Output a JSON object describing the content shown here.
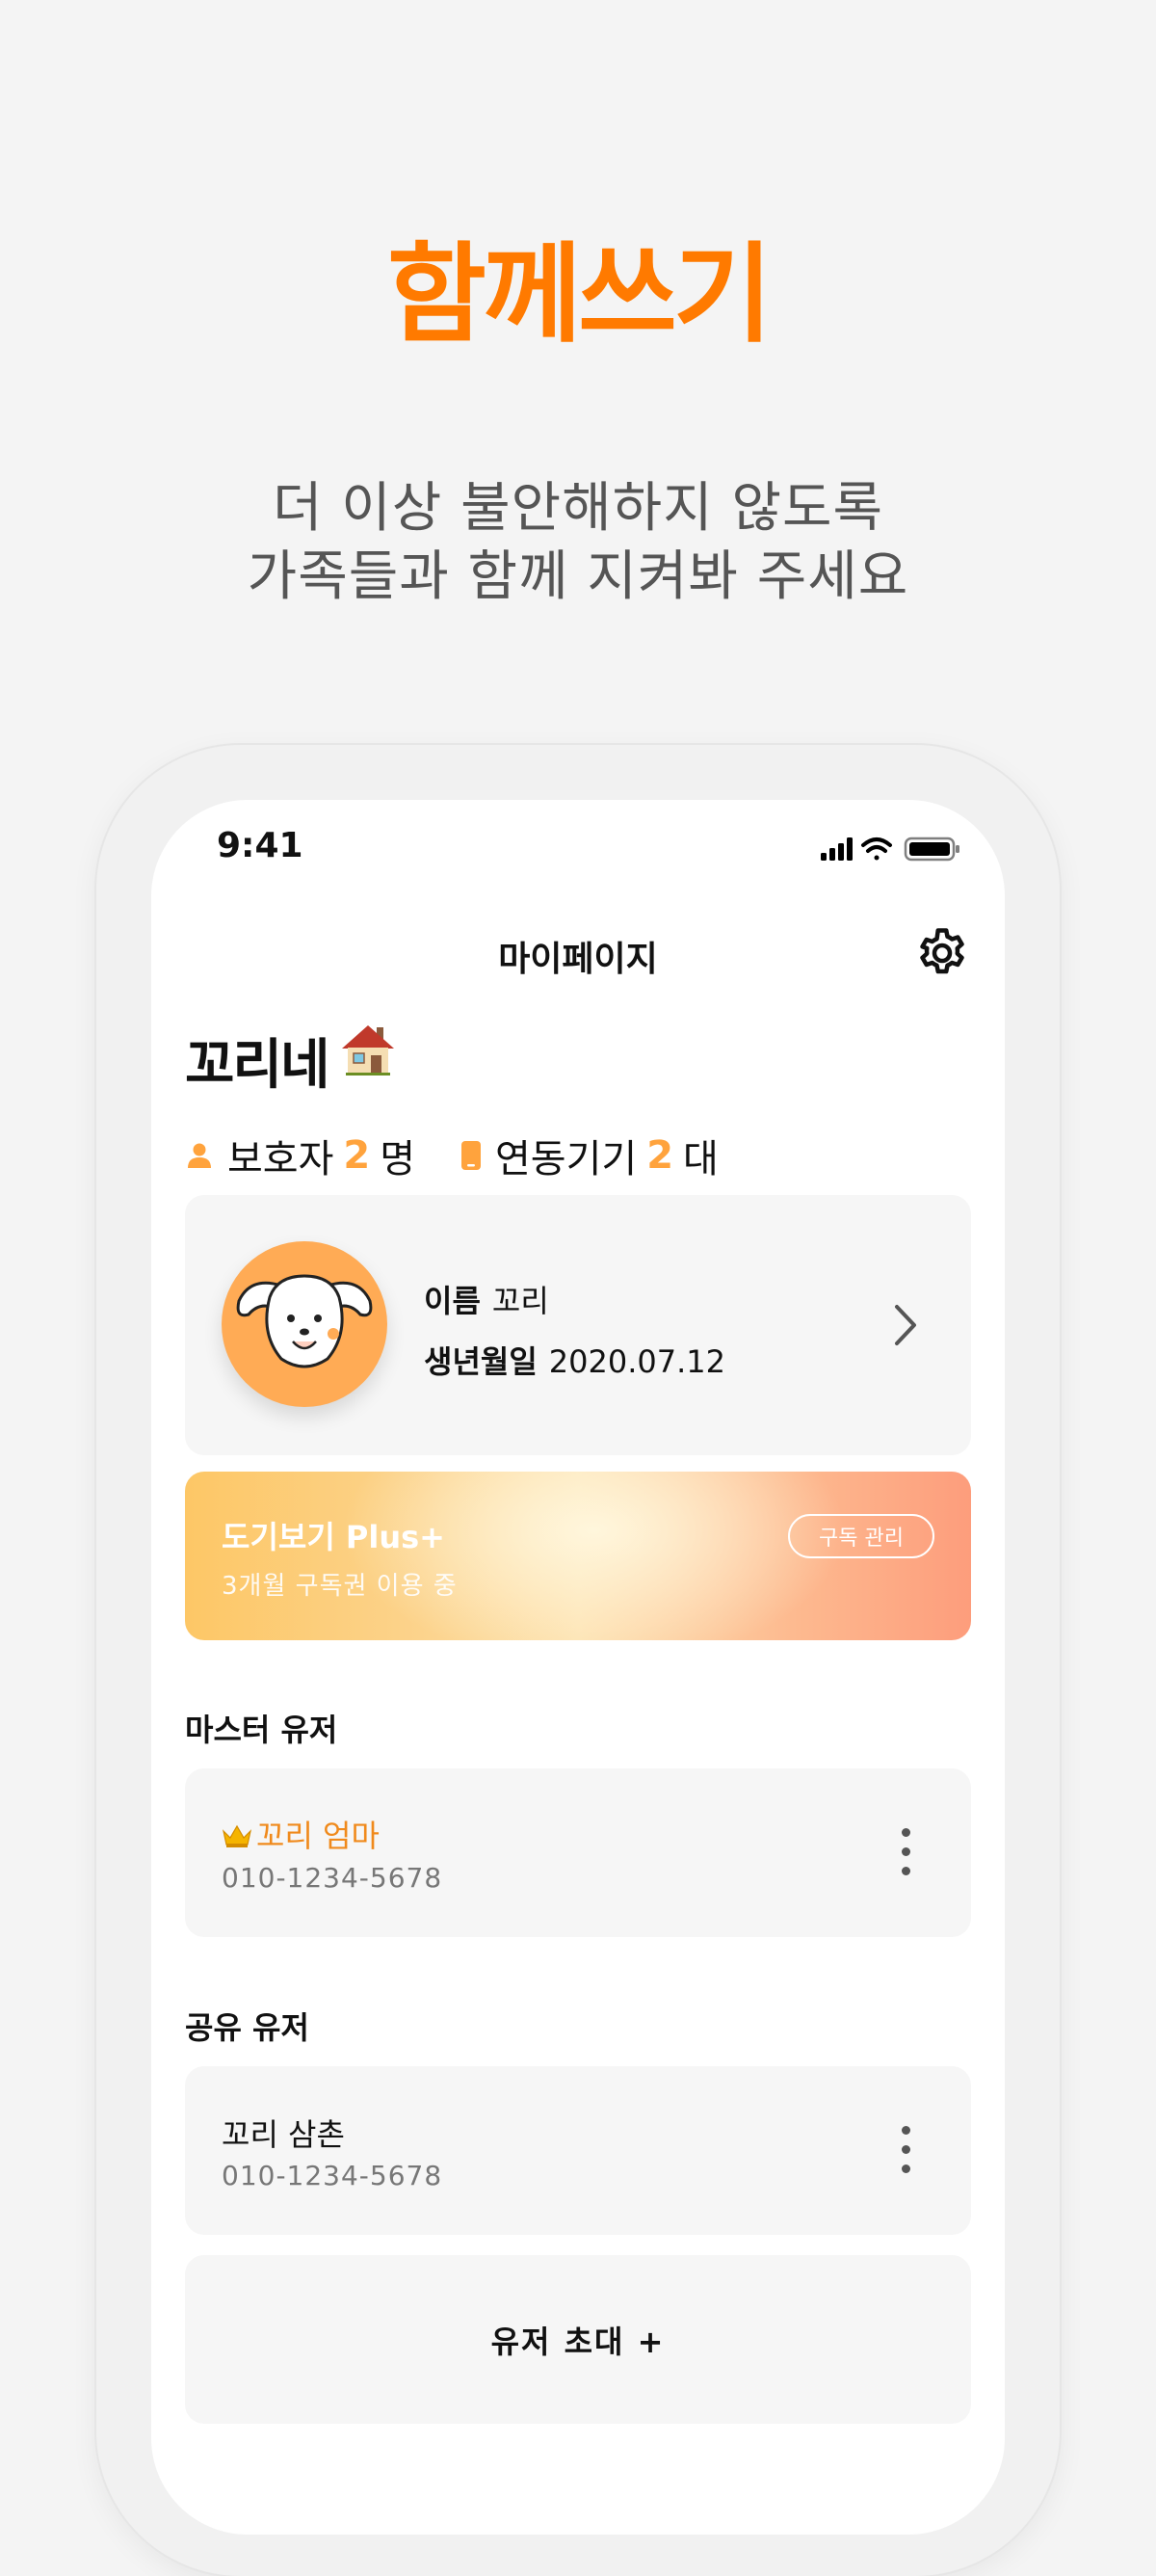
{
  "hero": {
    "title": "함께쓰기",
    "subtitle_line1": "더 이상 불안해하지 않도록",
    "subtitle_line2": "가족들과 함께 지켜봐 주세요"
  },
  "status_bar": {
    "time": "9:41"
  },
  "nav": {
    "title": "마이페이지",
    "settings_icon": "gear-icon"
  },
  "home": {
    "name": "꼬리네",
    "icon": "house-icon",
    "guardian_label": "보호자",
    "guardian_count": "2",
    "guardian_unit": "명",
    "device_label": "연동기기",
    "device_count": "2",
    "device_unit": "대"
  },
  "pet": {
    "name_label": "이름",
    "name_value": "꼬리",
    "birth_label": "생년월일",
    "birth_value": "2020.07.12"
  },
  "subscription": {
    "title": "도기보기 Plus+",
    "desc": "3개월 구독권 이용 중",
    "manage_label": "구독 관리"
  },
  "master_section": {
    "title": "마스터 유저",
    "user": {
      "name": "꼬리 엄마",
      "phone": "010-1234-5678"
    }
  },
  "shared_section": {
    "title": "공유 유저",
    "users": [
      {
        "name": "꼬리 삼촌",
        "phone": "010-1234-5678"
      }
    ],
    "invite_label": "유저 초대 +"
  },
  "colors": {
    "accent": "#ff7a00",
    "count_highlight": "#ffa33d",
    "master_name": "#f08a1c",
    "avatar_bg": "#ffab55"
  }
}
